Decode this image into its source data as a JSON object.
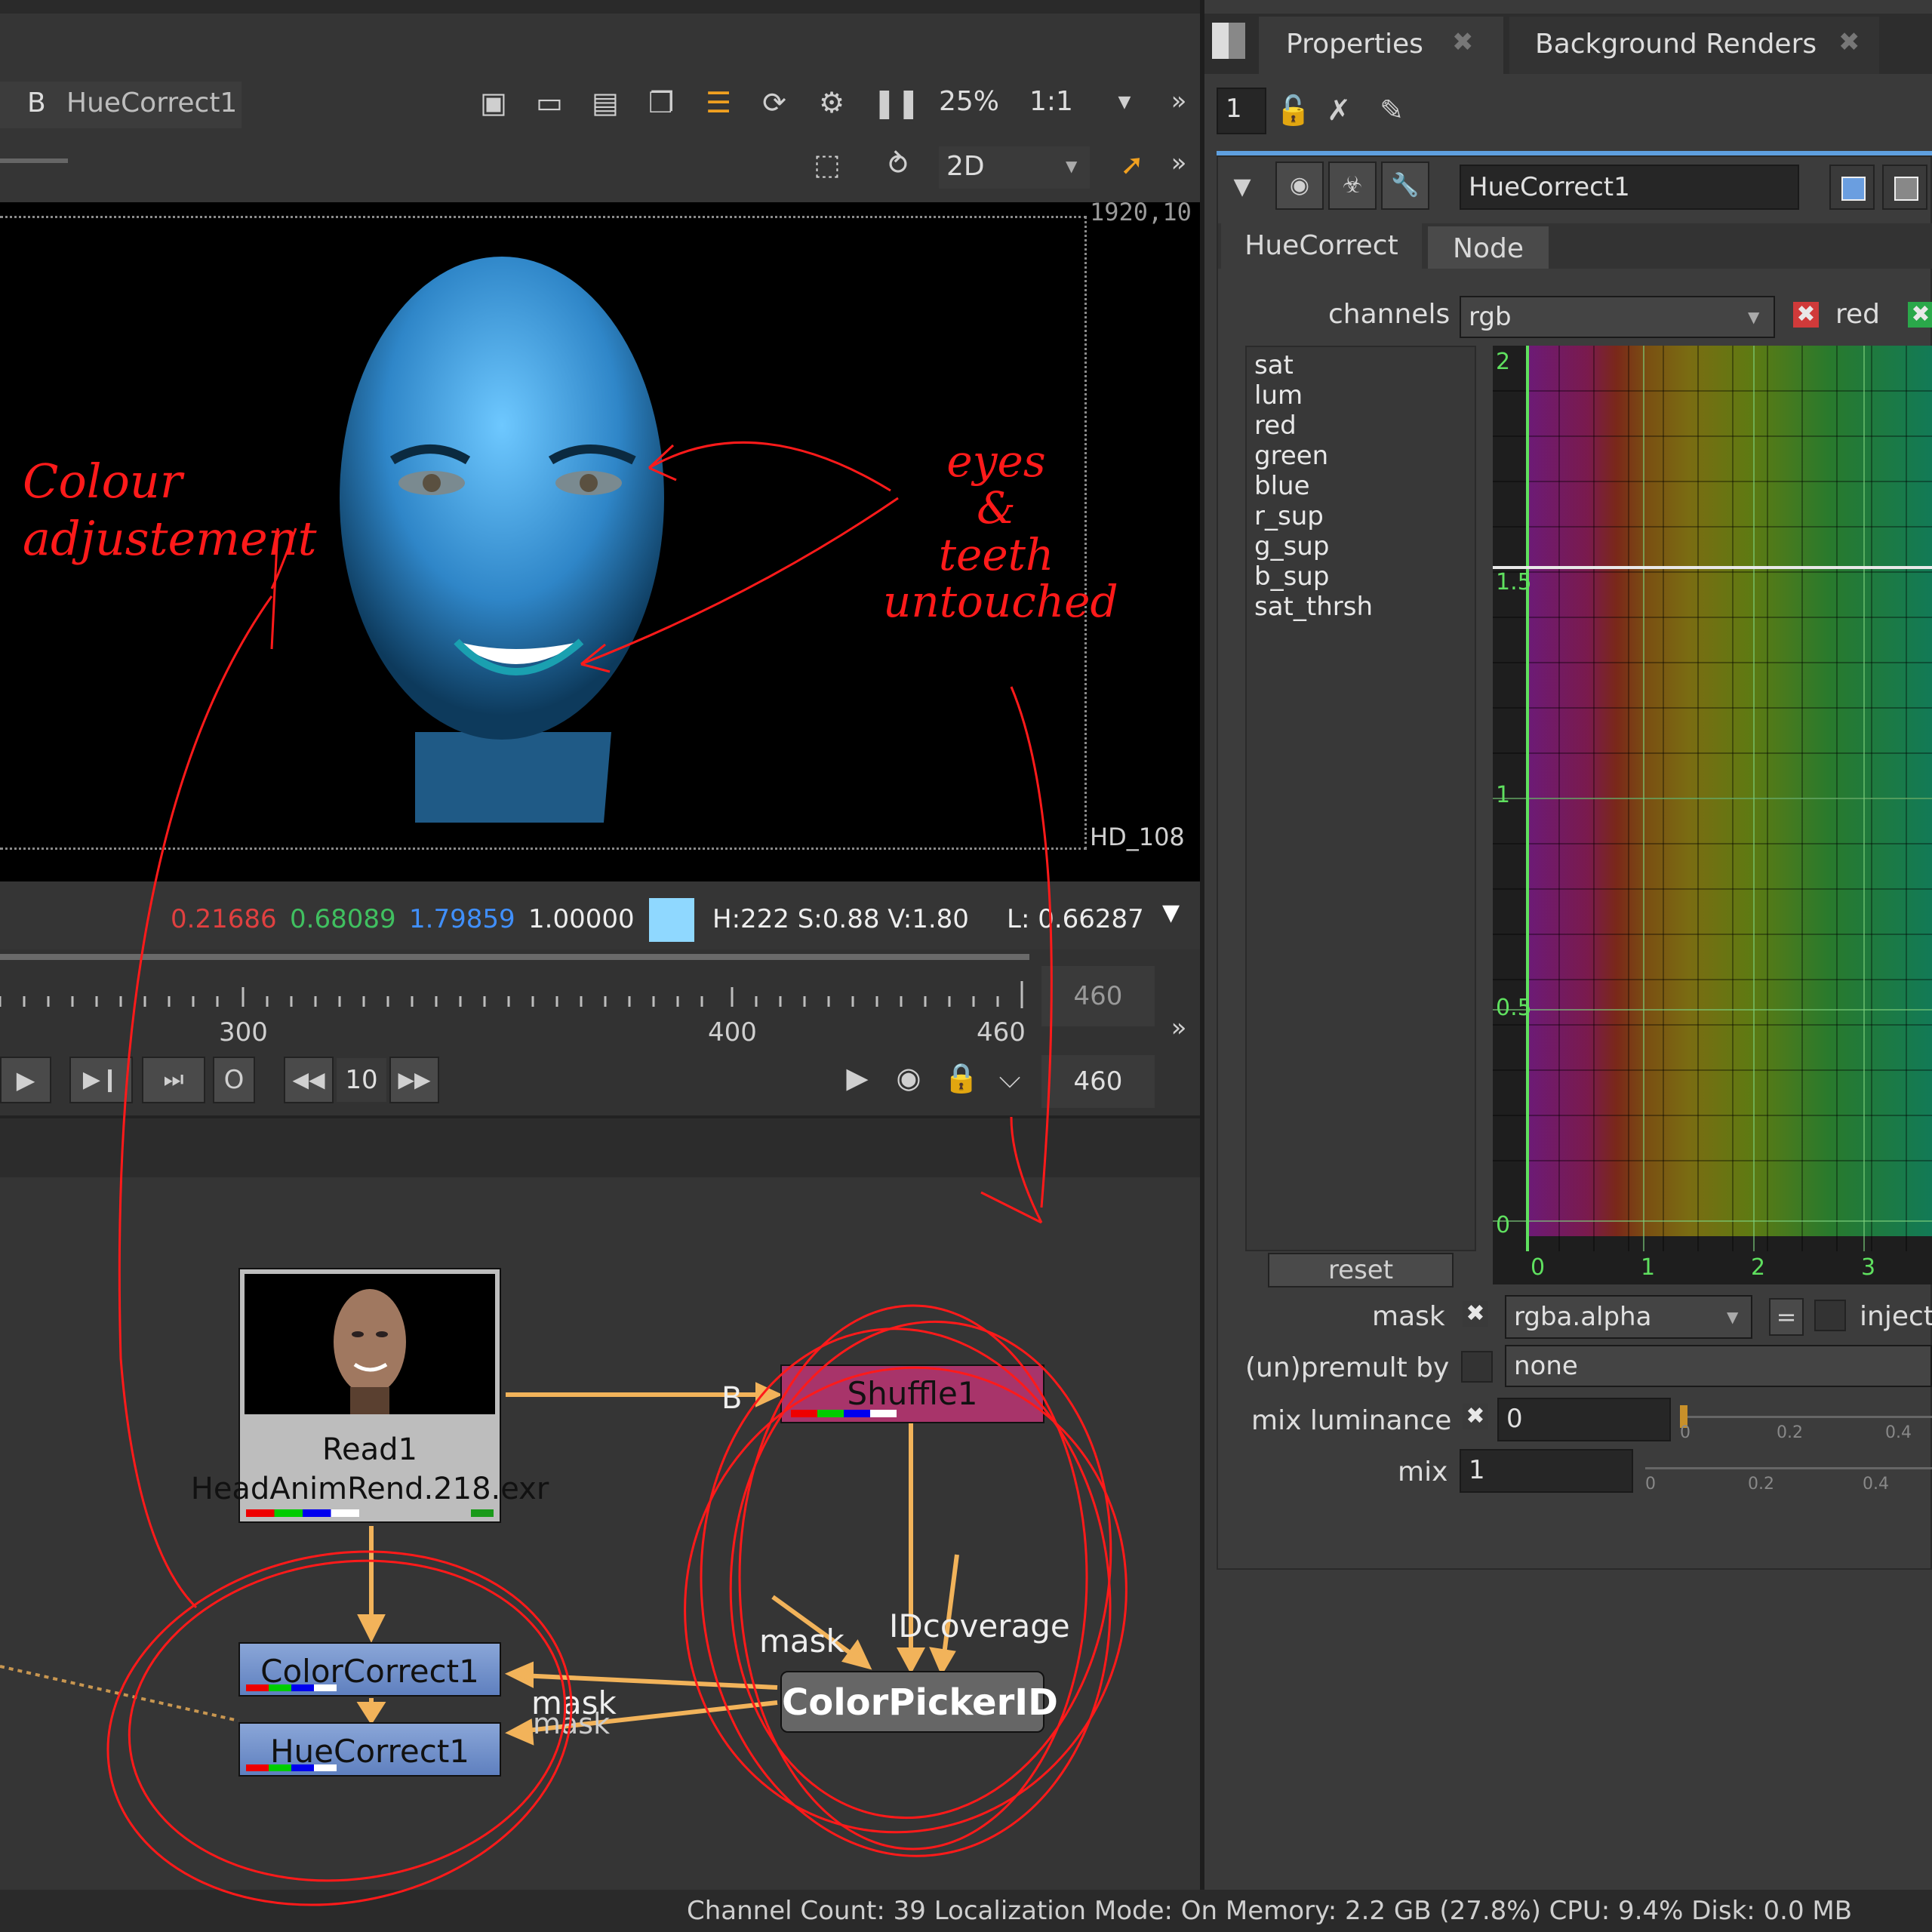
{
  "viewer": {
    "input_b_label": "B",
    "input_b_node": "HueCorrect1",
    "zoom": "25%",
    "ratio": "1:1",
    "mode": "2D",
    "format_top": "1920,10",
    "format_bottom": "HD_108",
    "pixel_values": {
      "r": "0.21686",
      "g": "0.68089",
      "b": "1.79859",
      "a": "1.00000",
      "hsv": "H:222 S:0.88 V:1.80",
      "lum": "L: 0.66287",
      "swatch_color": "#8fd8ff"
    }
  },
  "timeline": {
    "ticks": [
      "300",
      "400",
      "460"
    ],
    "end_frame_top": "460",
    "end_frame_bottom": "460",
    "step": "10",
    "o_button": "O"
  },
  "nodegraph": {
    "read_title": "Read1",
    "read_file": "HeadAnimRend.218.exr",
    "shuffle": "Shuffle1",
    "shuffle_input": "B",
    "colorcorrect": "ColorCorrect1",
    "huecorrect": "HueCorrect1",
    "colorpicker": "ColorPickerID",
    "label_mask1": "mask",
    "label_mask2": "mask",
    "label_mask3": "mask",
    "label_idcoverage": "IDcoverage"
  },
  "annotations": {
    "note1": "Colour adjustement",
    "note2_line1": "eyes",
    "note2_line2": "&",
    "note2_line3": "teeth",
    "note2_line4": "untouched"
  },
  "properties": {
    "tabs": [
      "Properties",
      "Background Renders"
    ],
    "max_panels": "1",
    "node_name": "HueCorrect1",
    "subtabs": [
      "HueCorrect",
      "Node"
    ],
    "channels_label": "channels",
    "channels_value": "rgb",
    "red_label": "red",
    "curves": [
      "sat",
      "lum",
      "red",
      "green",
      "blue",
      "r_sup",
      "g_sup",
      "b_sup",
      "sat_thrsh"
    ],
    "graph_y_labels": [
      "2",
      "1.5",
      "1",
      "0.5",
      "0"
    ],
    "graph_x_labels": [
      "0",
      "1",
      "2",
      "3"
    ],
    "reset": "reset",
    "mask_label": "mask",
    "mask_value": "rgba.alpha",
    "mask_eq": "=",
    "inject_label": "inject",
    "premult_label": "(un)premult by",
    "premult_value": "none",
    "mixlum_label": "mix luminance",
    "mixlum_value": "0",
    "mix_label": "mix",
    "mix_value": "1",
    "slider_ticks": [
      "0",
      "0.2",
      "0.4"
    ]
  },
  "statusbar": {
    "text": "Channel Count: 39  Localization Mode: On  Memory: 2.2 GB (27.8%)  CPU: 9.4%  Disk: 0.0 MB"
  }
}
